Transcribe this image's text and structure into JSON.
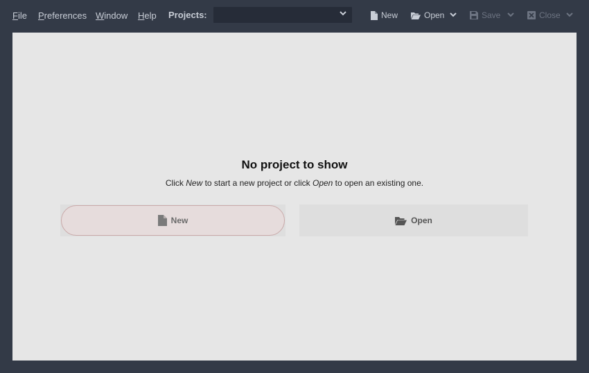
{
  "menu": {
    "file_u": "F",
    "file_rest": "ile",
    "preferences_u": "P",
    "preferences_rest": "references",
    "window_u": "W",
    "window_rest": "indow",
    "help_u": "H",
    "help_rest": "elp"
  },
  "projects": {
    "label": "Projects:",
    "selected": ""
  },
  "toolbar": {
    "new_label": "New",
    "open_label": "Open",
    "save_label": "Save",
    "close_label": "Close"
  },
  "empty_state": {
    "title": "No project to show",
    "desc_part1": "Click ",
    "desc_new": "New",
    "desc_part2": " to start a new project or click ",
    "desc_open": "Open",
    "desc_part3": " to open an existing one.",
    "new_button_label": "New",
    "open_button_label": "Open"
  },
  "icons": {
    "new": "file-icon",
    "open": "folder-open-icon",
    "save": "floppy-icon",
    "close": "close-box-icon",
    "dropdown": "chevron-down-icon"
  },
  "colors": {
    "background": "#333a47",
    "panel": "#e6e6e6",
    "new_button_border": "#c9a9a9",
    "new_button_fill": "#e6dcdc"
  }
}
